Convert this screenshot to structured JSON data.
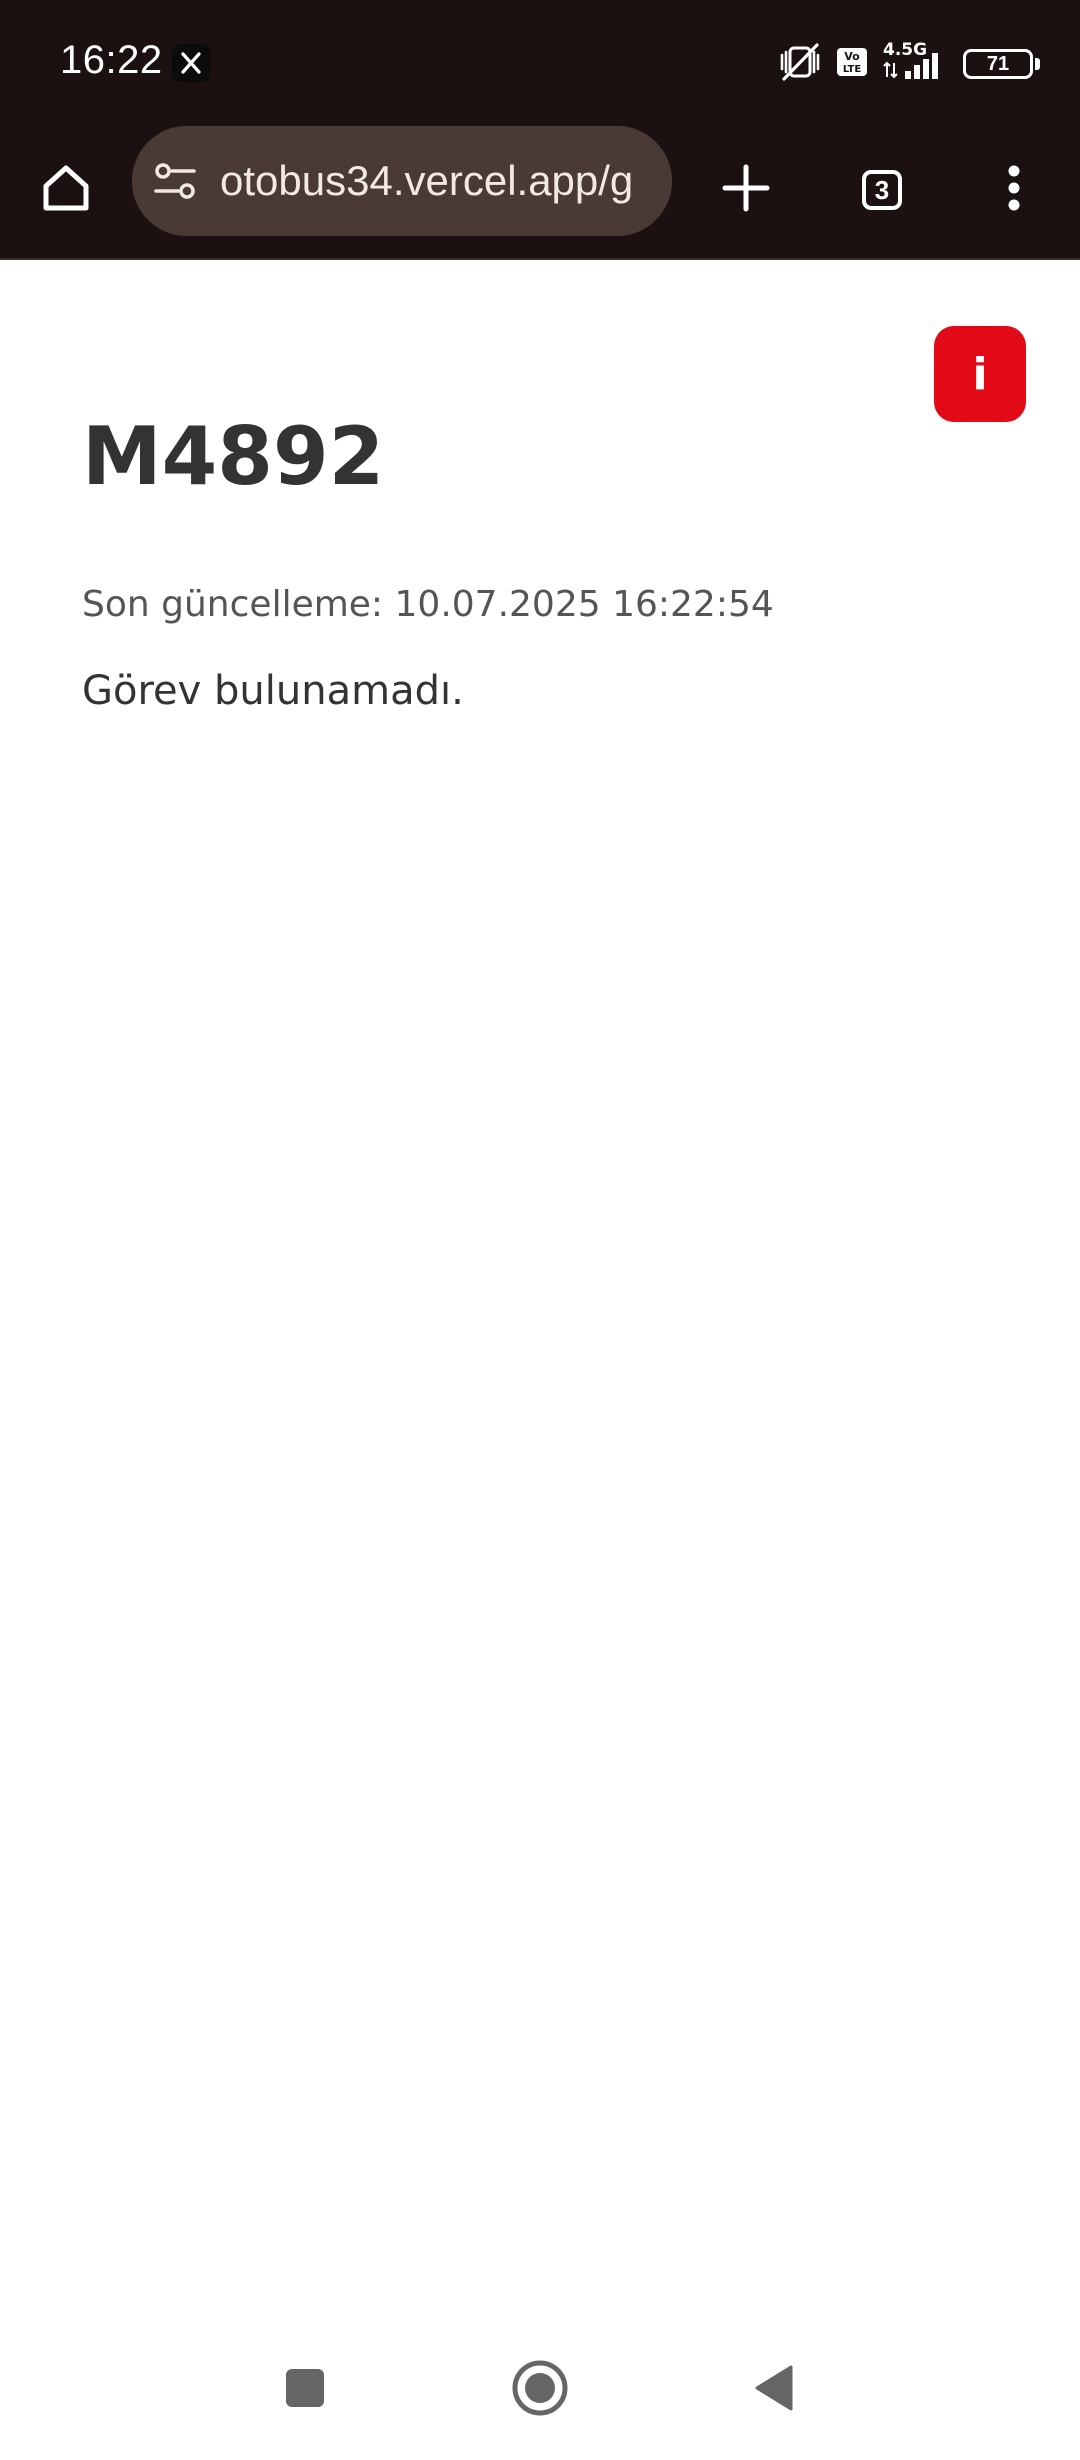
{
  "status_bar": {
    "time": "16:22",
    "notification_icons": [
      "x-icon"
    ],
    "system_icons": [
      "vibrate-mute-icon",
      "volte-icon",
      "4.5g-icon",
      "signal-icon",
      "battery-icon"
    ],
    "network_label": "4.5G",
    "volte_label": "Vo LTE",
    "battery_level": "71"
  },
  "browser": {
    "url": "otobus34.vercel.app/g",
    "tab_count": "3",
    "icons": {
      "home": "home-icon",
      "site_settings": "tune-icon",
      "new_tab": "plus-icon",
      "tabs": "tab-switcher-icon",
      "menu": "more-vert-icon"
    }
  },
  "page": {
    "info_label": "i",
    "title": "M4892",
    "last_updated": "Son güncelleme: 10.07.2025 16:22:54",
    "message": "Görev bulunamadı."
  },
  "colors": {
    "status_bar_bg": "#1c1111",
    "url_bar_bg": "#4a3a35",
    "info_button_bg": "#e30a17",
    "title_color": "#333333"
  },
  "nav_bar": {
    "icons": [
      "recents-square-icon",
      "home-circle-icon",
      "back-triangle-icon"
    ]
  }
}
